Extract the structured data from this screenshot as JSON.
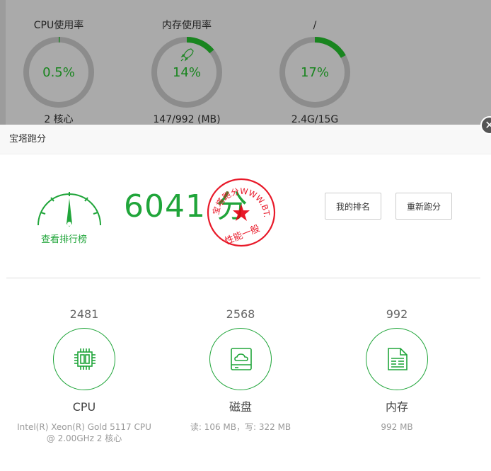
{
  "gauges": [
    {
      "label": "CPU使用率",
      "value": "0.5%",
      "sub": "2 核心",
      "percent": 0.5
    },
    {
      "label": "内存使用率",
      "value": "14%",
      "sub": "147/992 (MB)",
      "percent": 14
    },
    {
      "label": "/",
      "value": "17%",
      "sub": "2.4G/15G",
      "percent": 17
    }
  ],
  "dialog": {
    "title": "宝塔跑分",
    "close_glyph": "✕",
    "leaderboard_link": "查看排行榜",
    "score": "6041 分",
    "stamp_top": "宝塔跑分WWW.BT.CN",
    "stamp_bottom": "性能一般",
    "rank_button": "我的排名",
    "retest_button": "重新跑分"
  },
  "metrics": [
    {
      "value": "2481",
      "name": "CPU",
      "detail": "Intel(R) Xeon(R) Gold 5117 CPU @ 2.00GHz 2 核心",
      "icon": "cpu-chip-icon"
    },
    {
      "value": "2568",
      "name": "磁盘",
      "detail": "读: 106 MB，写: 322 MB",
      "icon": "disk-cloud-icon"
    },
    {
      "value": "992",
      "name": "内存",
      "detail": "992 MB",
      "icon": "memory-card-icon"
    }
  ],
  "colors": {
    "accent": "#20a53a",
    "stamp": "#e60012",
    "ring": "#8c8c8c"
  }
}
